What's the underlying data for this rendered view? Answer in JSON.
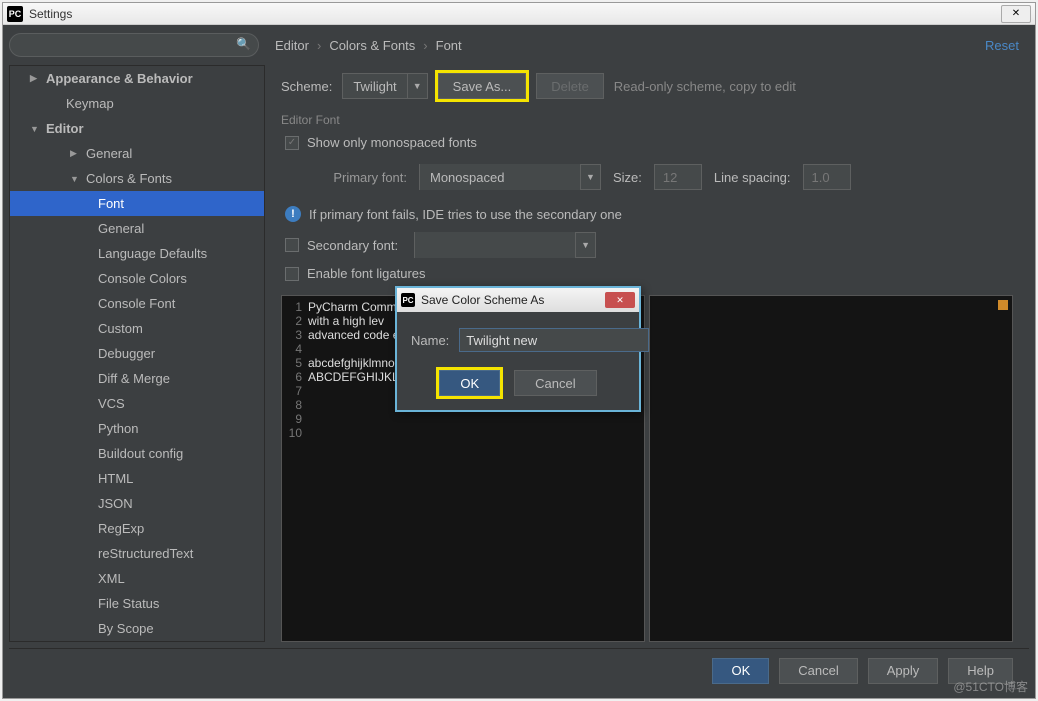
{
  "window": {
    "title": "Settings",
    "app_icon_text": "PC"
  },
  "breadcrumb": {
    "a": "Editor",
    "b": "Colors & Fonts",
    "c": "Font"
  },
  "reset_label": "Reset",
  "sidebar": {
    "items": [
      {
        "label": "Appearance & Behavior",
        "level": "l1",
        "exp": "closed"
      },
      {
        "label": "Keymap",
        "level": "l2"
      },
      {
        "label": "Editor",
        "level": "l1",
        "exp": "open"
      },
      {
        "label": "General",
        "level": "l3",
        "exp": "closed"
      },
      {
        "label": "Colors & Fonts",
        "level": "l3",
        "exp": "open"
      },
      {
        "label": "Font",
        "level": "l4",
        "selected": true
      },
      {
        "label": "General",
        "level": "l4"
      },
      {
        "label": "Language Defaults",
        "level": "l4"
      },
      {
        "label": "Console Colors",
        "level": "l4"
      },
      {
        "label": "Console Font",
        "level": "l4"
      },
      {
        "label": "Custom",
        "level": "l4"
      },
      {
        "label": "Debugger",
        "level": "l4"
      },
      {
        "label": "Diff & Merge",
        "level": "l4"
      },
      {
        "label": "VCS",
        "level": "l4"
      },
      {
        "label": "Python",
        "level": "l4"
      },
      {
        "label": "Buildout config",
        "level": "l4"
      },
      {
        "label": "HTML",
        "level": "l4"
      },
      {
        "label": "JSON",
        "level": "l4"
      },
      {
        "label": "RegExp",
        "level": "l4"
      },
      {
        "label": "reStructuredText",
        "level": "l4"
      },
      {
        "label": "XML",
        "level": "l4"
      },
      {
        "label": "File Status",
        "level": "l4"
      },
      {
        "label": "By Scope",
        "level": "l4"
      }
    ]
  },
  "scheme": {
    "label": "Scheme:",
    "value": "Twilight",
    "save_as": "Save As...",
    "delete": "Delete",
    "readonly_msg": "Read-only scheme, copy to edit"
  },
  "editor_font": {
    "group": "Editor Font",
    "show_mono": "Show only monospaced fonts",
    "primary_label": "Primary font:",
    "primary_value": "Monospaced",
    "size_label": "Size:",
    "size_value": "12",
    "spacing_label": "Line spacing:",
    "spacing_value": "1.0",
    "fallback_msg": "If primary font fails, IDE tries to use the secondary one",
    "secondary_label": "Secondary font:",
    "ligatures": "Enable font ligatures"
  },
  "preview": {
    "lines": [
      "PyCharm Communi",
      "with a high lev",
      "advanced code e",
      "",
      "abcdefghijklmnopqrstuvwxyz 0123456789 (){}[]",
      "ABCDEFGHIJKLMNOPQRSTUVWXYZ +-*/= .,;:!? #&$%@|^",
      "",
      "",
      "",
      ""
    ]
  },
  "dialog": {
    "title": "Save Color Scheme As",
    "name_label": "Name:",
    "name_value": "Twilight new",
    "ok": "OK",
    "cancel": "Cancel"
  },
  "footer": {
    "ok": "OK",
    "cancel": "Cancel",
    "apply": "Apply",
    "help": "Help"
  },
  "watermark": "@51CTO博客"
}
